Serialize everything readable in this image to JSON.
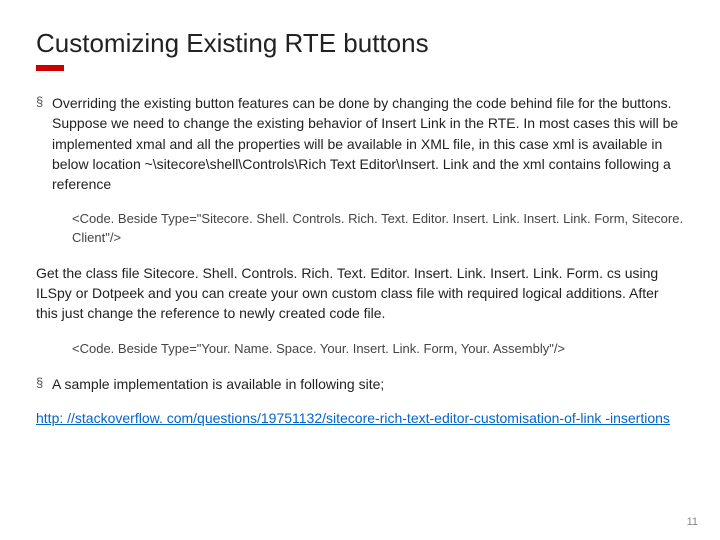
{
  "title": "Customizing Existing RTE buttons",
  "bullets": {
    "b1": "Overriding the existing button features can be done by changing the code behind file for the  buttons. Suppose we need to change the existing behavior of Insert Link in the RTE. In most cases this will be implemented xmal and all the properties  will be available in XML file, in this case xml is available in below location  ~\\sitecore\\shell\\Controls\\Rich Text Editor\\Insert. Link and the xml contains  following a reference",
    "b2": "A sample implementation is available in following site;"
  },
  "code": {
    "c1": "<Code. Beside Type=\"Sitecore. Shell. Controls. Rich. Text. Editor. Insert. Link. Insert. Link. Form, Sitecore. Client\"/>",
    "c2": "<Code. Beside Type=\"Your. Name. Space. Your. Insert. Link. Form, Your. Assembly\"/>"
  },
  "para": {
    "p1": "Get the class file Sitecore. Shell. Controls. Rich. Text. Editor. Insert. Link. Insert. Link. Form. cs using ILSpy or Dotpeek and you can create your own custom class file with required logical additions. After this just change the reference to newly created code file."
  },
  "link": "http: //stackoverflow. com/questions/19751132/sitecore-rich-text-editor-customisation-of-link -insertions",
  "page_num": "11"
}
